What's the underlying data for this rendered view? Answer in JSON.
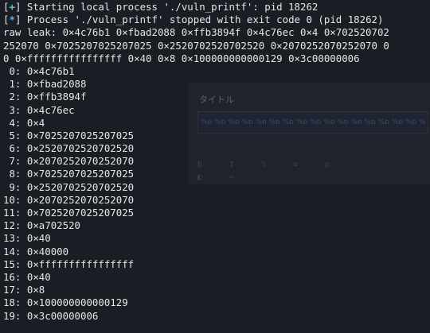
{
  "status_lines": [
    {
      "symbol": "+",
      "symbol_color": "#4fd1a5",
      "text": " Starting local process './vuln_printf': pid 18262"
    },
    {
      "symbol": "*",
      "symbol_color": "#5aa9f5",
      "text": " Process './vuln_printf' stopped with exit code 0 (pid 18262)"
    }
  ],
  "raw_leak_lines": [
    "raw leak: 0×4c76b1 0×fbad2088 0×ffb3894f 0×4c76ec 0×4 0×702520702",
    "252070 0×7025207025207025 0×2520702520702520 0×2070252070252070 0",
    "0 0×ffffffffffffffff 0×40 0×8 0×100000000000129 0×3c00000006"
  ],
  "leaks": [
    {
      "index": " 0:",
      "value": "0×4c76b1"
    },
    {
      "index": " 1:",
      "value": "0×fbad2088"
    },
    {
      "index": " 2:",
      "value": "0×ffb3894f"
    },
    {
      "index": " 3:",
      "value": "0×4c76ec"
    },
    {
      "index": " 4:",
      "value": "0×4"
    },
    {
      "index": " 5:",
      "value": "0×7025207025207025"
    },
    {
      "index": " 6:",
      "value": "0×2520702520702520"
    },
    {
      "index": " 7:",
      "value": "0×2070252070252070"
    },
    {
      "index": " 8:",
      "value": "0×7025207025207025"
    },
    {
      "index": " 9:",
      "value": "0×2520702520702520"
    },
    {
      "index": "10:",
      "value": "0×2070252070252070"
    },
    {
      "index": "11:",
      "value": "0×7025207025207025"
    },
    {
      "index": "12:",
      "value": "0×a702520"
    },
    {
      "index": "13:",
      "value": "0×40"
    },
    {
      "index": "14:",
      "value": "0×40000"
    },
    {
      "index": "15:",
      "value": "0×ffffffffffffffff"
    },
    {
      "index": "16:",
      "value": "0×40"
    },
    {
      "index": "17:",
      "value": "0×8"
    },
    {
      "index": "18:",
      "value": "0×100000000000129"
    },
    {
      "index": "19:",
      "value": "0×3c00000006"
    }
  ],
  "background_window": {
    "title": "タイトル",
    "field_text": "%p %p %p %p %p %p %p %p %p %p %p %p %p %p %p %p %p %p %p %p",
    "toolbar_icons": "B I S ≡ ⊡ ◧ ⋯"
  },
  "colors": {
    "background": "#1b1d24",
    "foreground": "#e6e6e6",
    "plus_symbol": "#4fd1a5",
    "star_symbol": "#5aa9f5"
  }
}
